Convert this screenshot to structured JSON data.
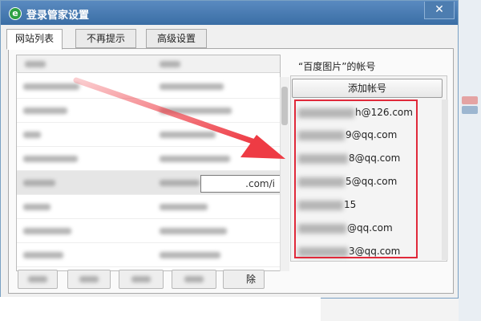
{
  "window": {
    "title": "登录管家设置",
    "close_glyph": "✕"
  },
  "tabs": [
    {
      "label": "网站列表",
      "active": true
    },
    {
      "label": "不再提示",
      "active": false
    },
    {
      "label": "高级设置",
      "active": false
    }
  ],
  "site_list": {
    "visible_url_fragment": ".com/i",
    "selected_row_index": 4
  },
  "accounts_panel": {
    "title": "“百度图片”的帐号",
    "add_button_label": "添加帐号",
    "accounts": [
      {
        "visible_suffix": "h@126.com"
      },
      {
        "visible_suffix": "9@qq.com"
      },
      {
        "visible_suffix": "8@qq.com"
      },
      {
        "visible_suffix": "5@qq.com"
      },
      {
        "visible_suffix": "15"
      },
      {
        "visible_suffix": "@qq.com"
      },
      {
        "visible_suffix": "3@qq.com"
      }
    ]
  },
  "bottom_buttons": {
    "last_button_visible_label": "除"
  },
  "colors": {
    "titlebar": "#3a6ea5",
    "highlight": "#e0293a",
    "annotation_arrow": "#ee3b44"
  }
}
